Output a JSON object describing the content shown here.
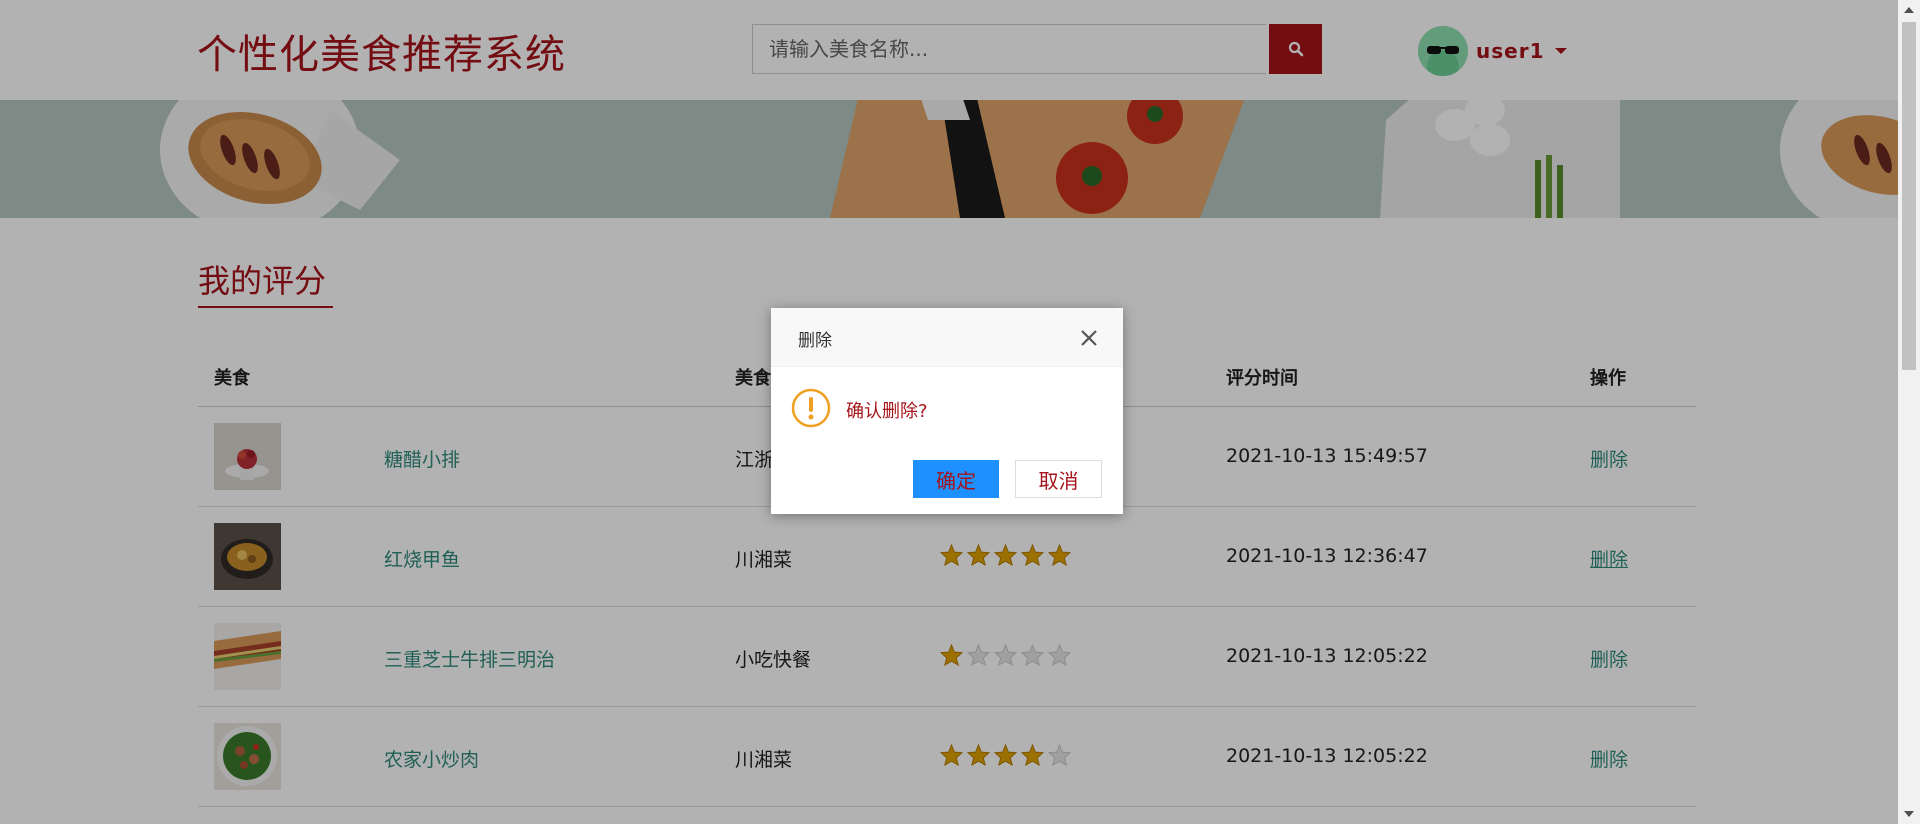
{
  "header": {
    "logo": "个性化美食推荐系统",
    "search_placeholder": "请输入美食名称...",
    "username": "user1"
  },
  "section": {
    "title": "我的评分"
  },
  "table": {
    "columns": [
      "美食",
      "美食",
      "评分时间",
      "操作"
    ],
    "rows": [
      {
        "name": "糖醋小排",
        "category": "江浙",
        "rating": null,
        "time": "2021-10-13 15:49:57",
        "action": "删除"
      },
      {
        "name": "红烧甲鱼",
        "category": "川湘菜",
        "rating": 5,
        "time": "2021-10-13 12:36:47",
        "action": "删除"
      },
      {
        "name": "三重芝士牛排三明治",
        "category": "小吃快餐",
        "rating": 1,
        "time": "2021-10-13 12:05:22",
        "action": "删除"
      },
      {
        "name": "农家小炒肉",
        "category": "川湘菜",
        "rating": 4,
        "time": "2021-10-13 12:05:22",
        "action": "删除"
      }
    ]
  },
  "dialog": {
    "title": "删除",
    "message": "确认删除?",
    "ok_label": "确定",
    "cancel_label": "取消"
  },
  "colors": {
    "brand": "#a5141b",
    "link": "#2f8a7a",
    "star": "#e0a100",
    "primary_button": "#1e90ff"
  },
  "icons": {
    "search": "search-icon",
    "close": "close-icon",
    "warning": "warning-icon",
    "star": "star-icon",
    "caret": "caret-down-icon"
  }
}
